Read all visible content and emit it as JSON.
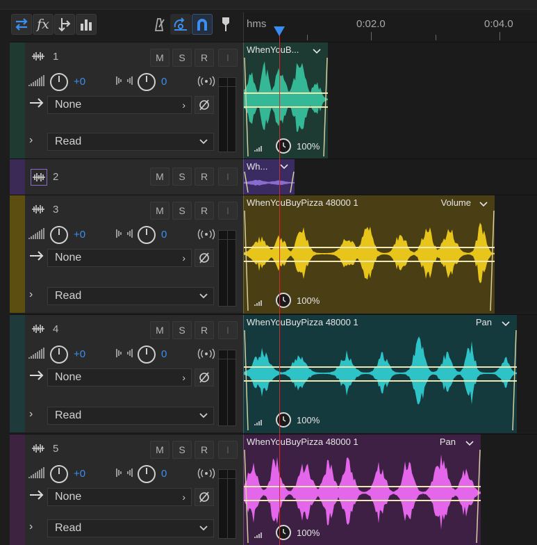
{
  "toolbar": {
    "buttons": [
      "switch-arrows-icon",
      "effects-icon",
      "send-icon",
      "levels-icon"
    ],
    "fx_label": "fx",
    "right_buttons": [
      "metronome-icon",
      "loop-icon",
      "snap-magnet-icon",
      "marker-icon"
    ]
  },
  "ruler": {
    "unit": "hms",
    "label_1": "0:02.0",
    "label_2": "0:04.0"
  },
  "colors": {
    "accent": "#3a8ff0",
    "playhead": "#d42a2a",
    "track1": "#34b895",
    "track2": "#6a4fa5",
    "track3": "#e0c010",
    "track4": "#2ab8c0",
    "track5": "#e060e8"
  },
  "common": {
    "m": "M",
    "s": "S",
    "r": "R",
    "i": "I",
    "vol": "+0",
    "pan": "0",
    "output": "None",
    "mode": "Read",
    "zoom": "100%"
  },
  "tracks": [
    {
      "number": "1",
      "clip_title": "WhenYouB..."
    },
    {
      "number": "2",
      "clip_title": "Wh..."
    },
    {
      "number": "3",
      "clip_title": "WhenYouBuyPizza 48000 1",
      "param": "Volume"
    },
    {
      "number": "4",
      "clip_title": "WhenYouBuyPizza 48000 1",
      "param": "Pan"
    },
    {
      "number": "5",
      "clip_title": "WhenYouBuyPizza 48000 1",
      "param": "Pan"
    }
  ]
}
